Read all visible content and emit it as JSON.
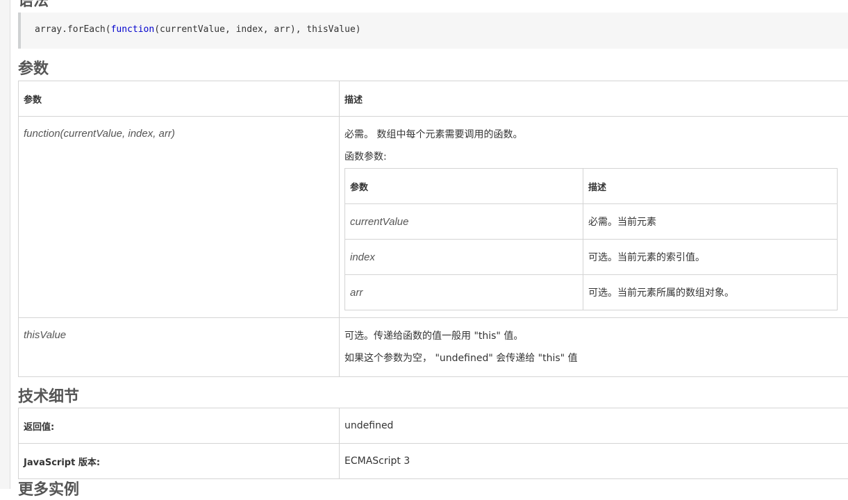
{
  "syntax": {
    "heading": "语法",
    "code_prefix": "array.forEach(",
    "code_keyword": "function",
    "code_suffix": "(currentValue, index, arr), thisValue)"
  },
  "params": {
    "heading": "参数",
    "header": {
      "col1": "参数",
      "col2": "描述"
    },
    "rows": [
      {
        "name": "function(currentValue, index, arr)",
        "desc_line1": "必需。 数组中每个元素需要调用的函数。",
        "desc_line2": "函数参数:",
        "inner_header": {
          "col1": "参数",
          "col2": "描述"
        },
        "inner_rows": [
          {
            "name": "currentValue",
            "desc": "必需。当前元素"
          },
          {
            "name": "index",
            "desc": "可选。当前元素的索引值。"
          },
          {
            "name": "arr",
            "desc": "可选。当前元素所属的数组对象。"
          }
        ]
      },
      {
        "name": "thisValue",
        "desc_line1": "可选。传递给函数的值一般用 \"this\" 值。",
        "desc_line2": "如果这个参数为空， \"undefined\" 会传递给 \"this\" 值"
      }
    ]
  },
  "tech": {
    "heading": "技术细节",
    "rows": [
      {
        "label": "返回值:",
        "value": "undefined"
      },
      {
        "label": "JavaScript 版本:",
        "value": "ECMAScript 3"
      }
    ]
  },
  "more": {
    "heading": "更多实例"
  }
}
